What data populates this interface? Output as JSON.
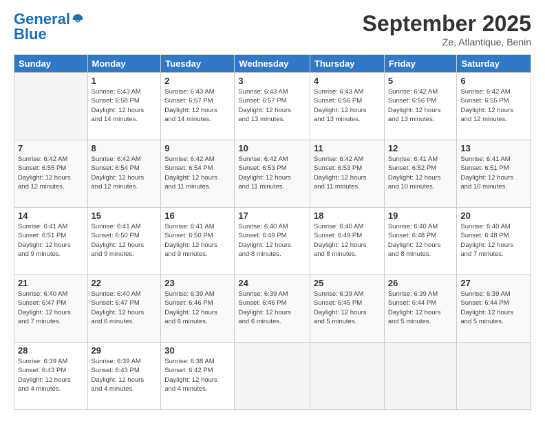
{
  "logo": {
    "line1": "General",
    "line2": "Blue"
  },
  "header": {
    "month_year": "September 2025",
    "location": "Ze, Atlantique, Benin"
  },
  "weekdays": [
    "Sunday",
    "Monday",
    "Tuesday",
    "Wednesday",
    "Thursday",
    "Friday",
    "Saturday"
  ],
  "weeks": [
    [
      {
        "day": "",
        "info": ""
      },
      {
        "day": "1",
        "info": "Sunrise: 6:43 AM\nSunset: 6:58 PM\nDaylight: 12 hours\nand 14 minutes."
      },
      {
        "day": "2",
        "info": "Sunrise: 6:43 AM\nSunset: 6:57 PM\nDaylight: 12 hours\nand 14 minutes."
      },
      {
        "day": "3",
        "info": "Sunrise: 6:43 AM\nSunset: 6:57 PM\nDaylight: 12 hours\nand 13 minutes."
      },
      {
        "day": "4",
        "info": "Sunrise: 6:43 AM\nSunset: 6:56 PM\nDaylight: 12 hours\nand 13 minutes."
      },
      {
        "day": "5",
        "info": "Sunrise: 6:42 AM\nSunset: 6:56 PM\nDaylight: 12 hours\nand 13 minutes."
      },
      {
        "day": "6",
        "info": "Sunrise: 6:42 AM\nSunset: 6:55 PM\nDaylight: 12 hours\nand 12 minutes."
      }
    ],
    [
      {
        "day": "7",
        "info": "Sunrise: 6:42 AM\nSunset: 6:55 PM\nDaylight: 12 hours\nand 12 minutes."
      },
      {
        "day": "8",
        "info": "Sunrise: 6:42 AM\nSunset: 6:54 PM\nDaylight: 12 hours\nand 12 minutes."
      },
      {
        "day": "9",
        "info": "Sunrise: 6:42 AM\nSunset: 6:54 PM\nDaylight: 12 hours\nand 11 minutes."
      },
      {
        "day": "10",
        "info": "Sunrise: 6:42 AM\nSunset: 6:53 PM\nDaylight: 12 hours\nand 11 minutes."
      },
      {
        "day": "11",
        "info": "Sunrise: 6:42 AM\nSunset: 6:53 PM\nDaylight: 12 hours\nand 11 minutes."
      },
      {
        "day": "12",
        "info": "Sunrise: 6:41 AM\nSunset: 6:52 PM\nDaylight: 12 hours\nand 10 minutes."
      },
      {
        "day": "13",
        "info": "Sunrise: 6:41 AM\nSunset: 6:51 PM\nDaylight: 12 hours\nand 10 minutes."
      }
    ],
    [
      {
        "day": "14",
        "info": "Sunrise: 6:41 AM\nSunset: 6:51 PM\nDaylight: 12 hours\nand 9 minutes."
      },
      {
        "day": "15",
        "info": "Sunrise: 6:41 AM\nSunset: 6:50 PM\nDaylight: 12 hours\nand 9 minutes."
      },
      {
        "day": "16",
        "info": "Sunrise: 6:41 AM\nSunset: 6:50 PM\nDaylight: 12 hours\nand 9 minutes."
      },
      {
        "day": "17",
        "info": "Sunrise: 6:40 AM\nSunset: 6:49 PM\nDaylight: 12 hours\nand 8 minutes."
      },
      {
        "day": "18",
        "info": "Sunrise: 6:40 AM\nSunset: 6:49 PM\nDaylight: 12 hours\nand 8 minutes."
      },
      {
        "day": "19",
        "info": "Sunrise: 6:40 AM\nSunset: 6:48 PM\nDaylight: 12 hours\nand 8 minutes."
      },
      {
        "day": "20",
        "info": "Sunrise: 6:40 AM\nSunset: 6:48 PM\nDaylight: 12 hours\nand 7 minutes."
      }
    ],
    [
      {
        "day": "21",
        "info": "Sunrise: 6:40 AM\nSunset: 6:47 PM\nDaylight: 12 hours\nand 7 minutes."
      },
      {
        "day": "22",
        "info": "Sunrise: 6:40 AM\nSunset: 6:47 PM\nDaylight: 12 hours\nand 6 minutes."
      },
      {
        "day": "23",
        "info": "Sunrise: 6:39 AM\nSunset: 6:46 PM\nDaylight: 12 hours\nand 6 minutes."
      },
      {
        "day": "24",
        "info": "Sunrise: 6:39 AM\nSunset: 6:46 PM\nDaylight: 12 hours\nand 6 minutes."
      },
      {
        "day": "25",
        "info": "Sunrise: 6:39 AM\nSunset: 6:45 PM\nDaylight: 12 hours\nand 5 minutes."
      },
      {
        "day": "26",
        "info": "Sunrise: 6:39 AM\nSunset: 6:44 PM\nDaylight: 12 hours\nand 5 minutes."
      },
      {
        "day": "27",
        "info": "Sunrise: 6:39 AM\nSunset: 6:44 PM\nDaylight: 12 hours\nand 5 minutes."
      }
    ],
    [
      {
        "day": "28",
        "info": "Sunrise: 6:39 AM\nSunset: 6:43 PM\nDaylight: 12 hours\nand 4 minutes."
      },
      {
        "day": "29",
        "info": "Sunrise: 6:39 AM\nSunset: 6:43 PM\nDaylight: 12 hours\nand 4 minutes."
      },
      {
        "day": "30",
        "info": "Sunrise: 6:38 AM\nSunset: 6:42 PM\nDaylight: 12 hours\nand 4 minutes."
      },
      {
        "day": "",
        "info": ""
      },
      {
        "day": "",
        "info": ""
      },
      {
        "day": "",
        "info": ""
      },
      {
        "day": "",
        "info": ""
      }
    ]
  ]
}
